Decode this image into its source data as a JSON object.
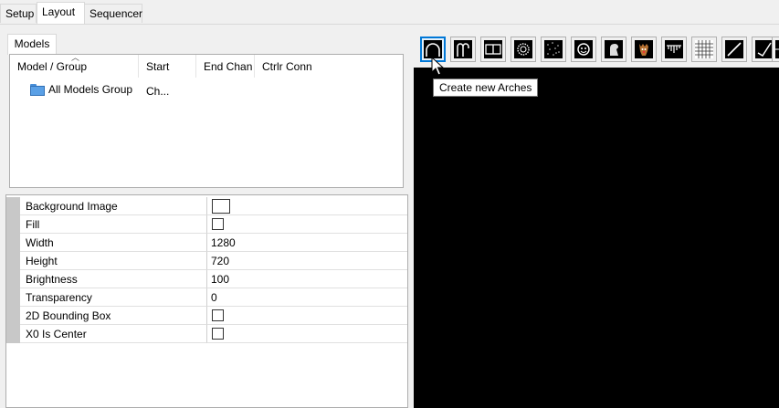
{
  "tabs": [
    {
      "label": "Setup"
    },
    {
      "label": "Layout"
    },
    {
      "label": "Sequencer"
    }
  ],
  "models_tab_label": "Models",
  "tree": {
    "columns": [
      "Model / Group",
      "Start Ch...",
      "End Chan",
      "Ctrlr Conn"
    ],
    "items": [
      {
        "label": "All Models Group",
        "icon": "folder-icon"
      }
    ]
  },
  "properties": [
    {
      "name": "Background Image",
      "type": "image",
      "value": ""
    },
    {
      "name": "Fill",
      "type": "checkbox",
      "value": false
    },
    {
      "name": "Width",
      "type": "text",
      "value": "1280"
    },
    {
      "name": "Height",
      "type": "text",
      "value": "720"
    },
    {
      "name": "Brightness",
      "type": "text",
      "value": "100"
    },
    {
      "name": "Transparency",
      "type": "text",
      "value": "0"
    },
    {
      "name": "2D Bounding Box",
      "type": "checkbox",
      "value": false
    },
    {
      "name": "X0 Is Center",
      "type": "checkbox",
      "value": false
    }
  ],
  "toolbar": {
    "buttons": [
      {
        "icon": "arches-icon",
        "selected": true
      },
      {
        "icon": "candy-canes-icon"
      },
      {
        "icon": "channel-block-icon"
      },
      {
        "icon": "circle-icon"
      },
      {
        "icon": "cube-icon"
      },
      {
        "icon": "custom-icon"
      },
      {
        "icon": "dmx-icon"
      },
      {
        "icon": "image-icon"
      },
      {
        "icon": "icicles-icon"
      },
      {
        "icon": "matrix-icon"
      },
      {
        "icon": "single-line-icon"
      },
      {
        "icon": "poly-line-icon"
      },
      {
        "icon": "sphere-icon"
      }
    ],
    "tooltip": "Create new Arches"
  },
  "colors": {
    "canvas": "#000000",
    "selected_border": "#0078d7"
  }
}
